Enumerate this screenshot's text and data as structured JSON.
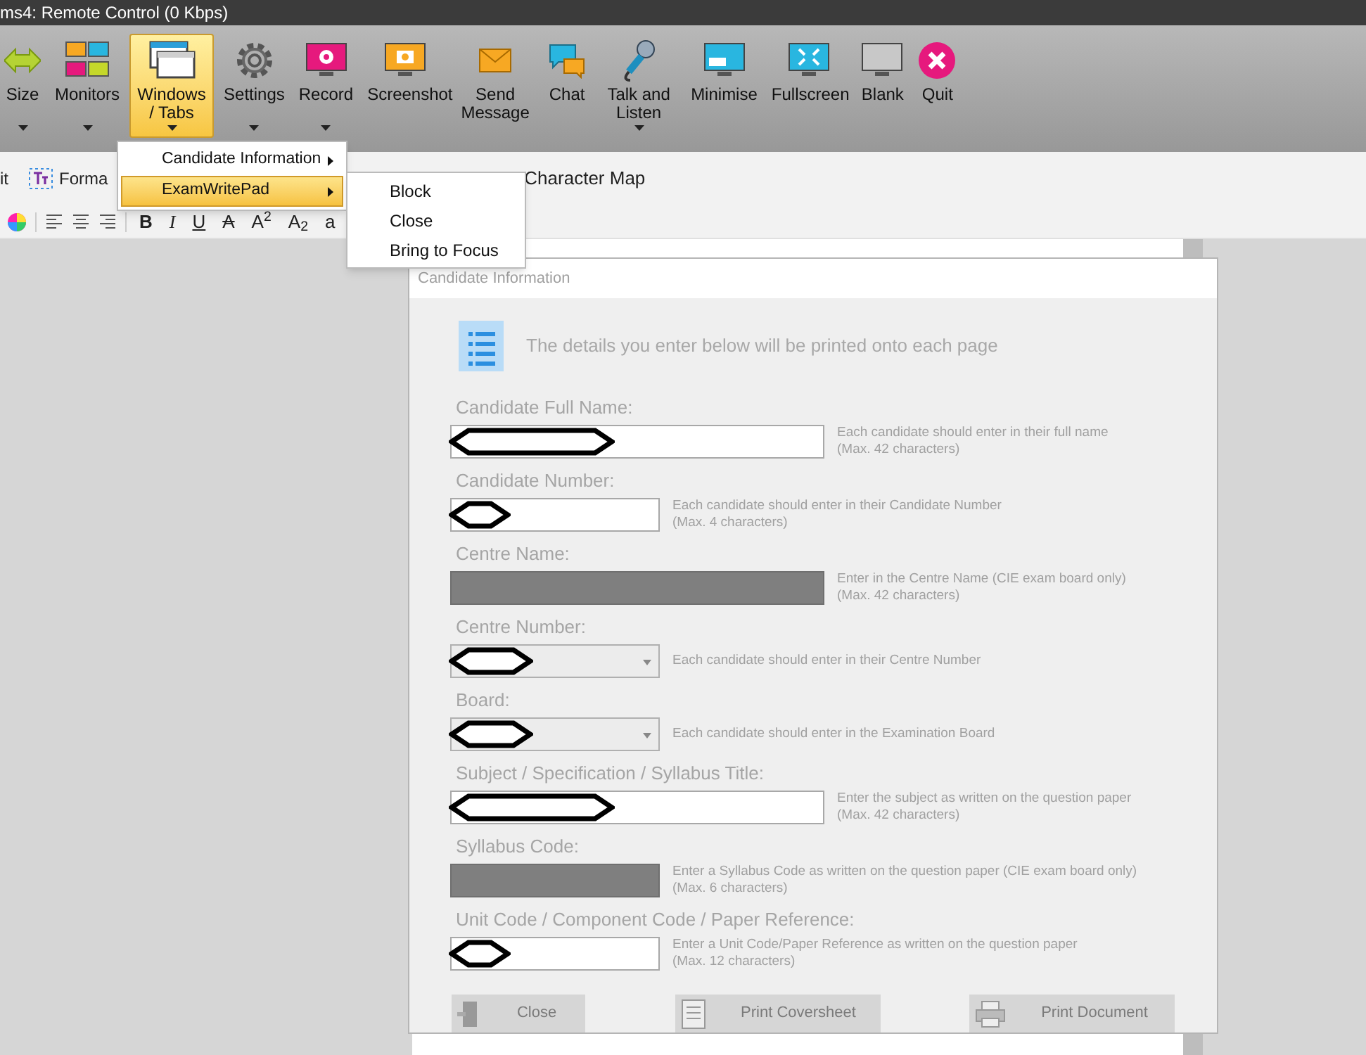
{
  "window": {
    "title": "ms4: Remote Control (0 Kbps)"
  },
  "toolbar": [
    {
      "label": "Size",
      "dropdown": true,
      "selected": false
    },
    {
      "label": "Monitors",
      "dropdown": true,
      "selected": false
    },
    {
      "label": "Windows / Tabs",
      "dropdown": true,
      "selected": true
    },
    {
      "label": "Settings",
      "dropdown": true,
      "selected": false
    },
    {
      "label": "Record",
      "dropdown": true,
      "selected": false
    },
    {
      "label": "Screenshot",
      "dropdown": false,
      "selected": false
    },
    {
      "label": "Send Message",
      "dropdown": false,
      "selected": false
    },
    {
      "label": "Chat",
      "dropdown": false,
      "selected": false
    },
    {
      "label": "Talk and Listen",
      "dropdown": true,
      "selected": false
    },
    {
      "label": "Minimise",
      "dropdown": false,
      "selected": false
    },
    {
      "label": "Fullscreen",
      "dropdown": false,
      "selected": false
    },
    {
      "label": "Blank",
      "dropdown": false,
      "selected": false
    },
    {
      "label": "Quit",
      "dropdown": false,
      "selected": false
    }
  ],
  "menu": {
    "items": [
      {
        "label": "Candidate Information",
        "selected": false
      },
      {
        "label": "ExamWritePad",
        "selected": true
      }
    ],
    "submenu": [
      "Block",
      "Close",
      "Bring to Focus"
    ]
  },
  "ribbon": {
    "left_text": "it",
    "format_label": "Forma",
    "character_map": "Character Map"
  },
  "formatting": [
    {
      "label": "B",
      "kind": "bold"
    },
    {
      "label": "I",
      "kind": "italic"
    },
    {
      "label": "U",
      "kind": "underline"
    },
    {
      "label": "A",
      "kind": "strike"
    },
    {
      "label": "A$^{2}$",
      "kind": "plain"
    },
    {
      "label": "A$_{2}$",
      "kind": "plain"
    },
    {
      "label": "a",
      "kind": "plain"
    }
  ],
  "dialog": {
    "title": "Candidate Information",
    "intro": "The details you enter below will be printed onto each page",
    "fields": [
      {
        "label": "Candidate Full Name:",
        "kind": "text",
        "wide": true,
        "disabled": false,
        "redacted": true,
        "hint": [
          "Each candidate should enter in their full name",
          "(Max. 42 characters)"
        ]
      },
      {
        "label": "Candidate Number:",
        "kind": "text",
        "wide": false,
        "disabled": false,
        "redacted": true,
        "hint": [
          "Each candidate should enter in their Candidate Number",
          "(Max. 4 characters)"
        ]
      },
      {
        "label": "Centre Name:",
        "kind": "text",
        "wide": true,
        "disabled": true,
        "redacted": false,
        "hint": [
          "Enter in the Centre Name (CIE exam board only)",
          "(Max. 42 characters)"
        ]
      },
      {
        "label": "Centre Number:",
        "kind": "select",
        "wide": false,
        "disabled": false,
        "redacted": true,
        "hint": [
          "Each candidate should enter in their Centre Number"
        ]
      },
      {
        "label": "Board:",
        "kind": "select",
        "wide": false,
        "disabled": false,
        "redacted": true,
        "hint": [
          "Each candidate should enter in the Examination Board"
        ]
      },
      {
        "label": "Subject / Specification / Syllabus Title:",
        "kind": "text",
        "wide": true,
        "disabled": false,
        "redacted": true,
        "hint": [
          "Enter the subject as written on the question paper",
          "(Max. 42 characters)"
        ]
      },
      {
        "label": "Syllabus Code:",
        "kind": "text",
        "wide": false,
        "disabled": true,
        "redacted": false,
        "hint": [
          "Enter a Syllabus Code as written on the question paper (CIE exam board only)",
          "(Max. 6 characters)"
        ]
      },
      {
        "label": "Unit Code / Component Code / Paper Reference:",
        "kind": "text",
        "wide": false,
        "disabled": false,
        "redacted": true,
        "hint": [
          "Enter a Unit Code/Paper Reference as written on the question paper",
          "(Max. 12 characters)"
        ]
      }
    ],
    "buttons": [
      {
        "label": "Close",
        "disabled": true
      },
      {
        "label": "Print Coversheet",
        "disabled": true
      },
      {
        "label": "Print Document",
        "disabled": true
      }
    ]
  }
}
